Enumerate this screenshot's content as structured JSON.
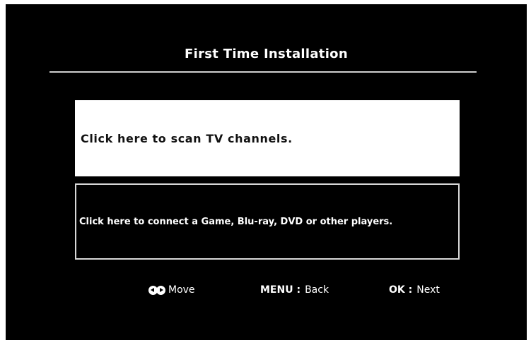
{
  "screen": {
    "title": "First Time Installation"
  },
  "options": {
    "scan_channels": "Click here to scan TV channels.",
    "connect_player": "Click here to connect a Game, Blu-ray, DVD or other players."
  },
  "footer": {
    "move_icon": "left-right-arrows-icon",
    "move_label": "Move",
    "menu_key": "MENU :",
    "menu_label": "Back",
    "ok_key": "OK :",
    "ok_label": "Next"
  },
  "colors": {
    "background": "#000000",
    "selected_option": "#ffffff",
    "text": "#ffffff"
  }
}
